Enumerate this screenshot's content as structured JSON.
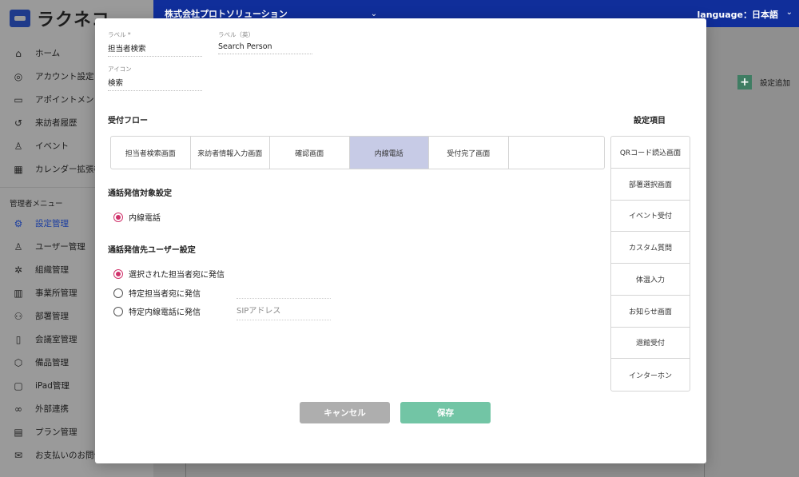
{
  "app": {
    "logo_text": "ラクネコ"
  },
  "sidebar": {
    "items": [
      {
        "label": "ホーム",
        "icon": "home-icon"
      },
      {
        "label": "アカウント設定",
        "icon": "account-circle-icon"
      },
      {
        "label": "アポイントメント",
        "icon": "id-card-icon"
      },
      {
        "label": "来訪者履歴",
        "icon": "history-icon"
      },
      {
        "label": "イベント",
        "icon": "person-icon"
      },
      {
        "label": "カレンダー拡張機能",
        "icon": "calendar-icon"
      }
    ],
    "admin_section_title": "管理者メニュー",
    "admin_items": [
      {
        "label": "設定管理",
        "icon": "gear-icon",
        "active": true
      },
      {
        "label": "ユーザー管理",
        "icon": "person-add-icon"
      },
      {
        "label": "組織管理",
        "icon": "organization-icon"
      },
      {
        "label": "事業所管理",
        "icon": "building-icon"
      },
      {
        "label": "部署管理",
        "icon": "group-icon"
      },
      {
        "label": "会議室管理",
        "icon": "door-icon"
      },
      {
        "label": "備品管理",
        "icon": "box-icon"
      },
      {
        "label": "iPad管理",
        "icon": "tablet-icon"
      },
      {
        "label": "外部連携",
        "icon": "link-icon"
      },
      {
        "label": "プラン管理",
        "icon": "card-icon"
      },
      {
        "label": "お支払いのお問合せ",
        "icon": "mail-icon"
      }
    ]
  },
  "topbar": {
    "company": "株式会社プロトソリューション",
    "language": "language：日本語"
  },
  "main": {
    "add_setting_label": "設定追加"
  },
  "modal": {
    "fields": {
      "label": {
        "label": "ラベル *",
        "value": "担当者検索"
      },
      "label_en": {
        "label": "ラベル（英）",
        "value": "Search Person"
      },
      "icon": {
        "label": "アイコン",
        "value": "検索"
      }
    },
    "flow_heading": "受付フロー",
    "flow_steps": [
      "担当者検索画面",
      "来訪者情報入力画面",
      "確認画面",
      "内線電話",
      "受付完了画面",
      ""
    ],
    "active_step_index": 3,
    "call_target_heading": "通話発信対象設定",
    "call_target_options": [
      "内線電話"
    ],
    "call_user_heading": "通話発信先ユーザー設定",
    "call_user_options": [
      "選択された担当者宛に発信",
      "特定担当者宛に発信",
      "特定内線電話に発信"
    ],
    "sip_placeholder": "SIPアドレス",
    "settings_heading": "設定項目",
    "settings_items": [
      "QRコード読込画面",
      "部署選択画面",
      "イベント受付",
      "カスタム質問",
      "体温入力",
      "お知らせ画面",
      "退館受付",
      "インターホン"
    ],
    "cancel_label": "キャンセル",
    "save_label": "保存",
    "colors": {
      "accent": "#d0326b",
      "save": "#72c5a5",
      "active_step": "#c7cbe6"
    }
  }
}
